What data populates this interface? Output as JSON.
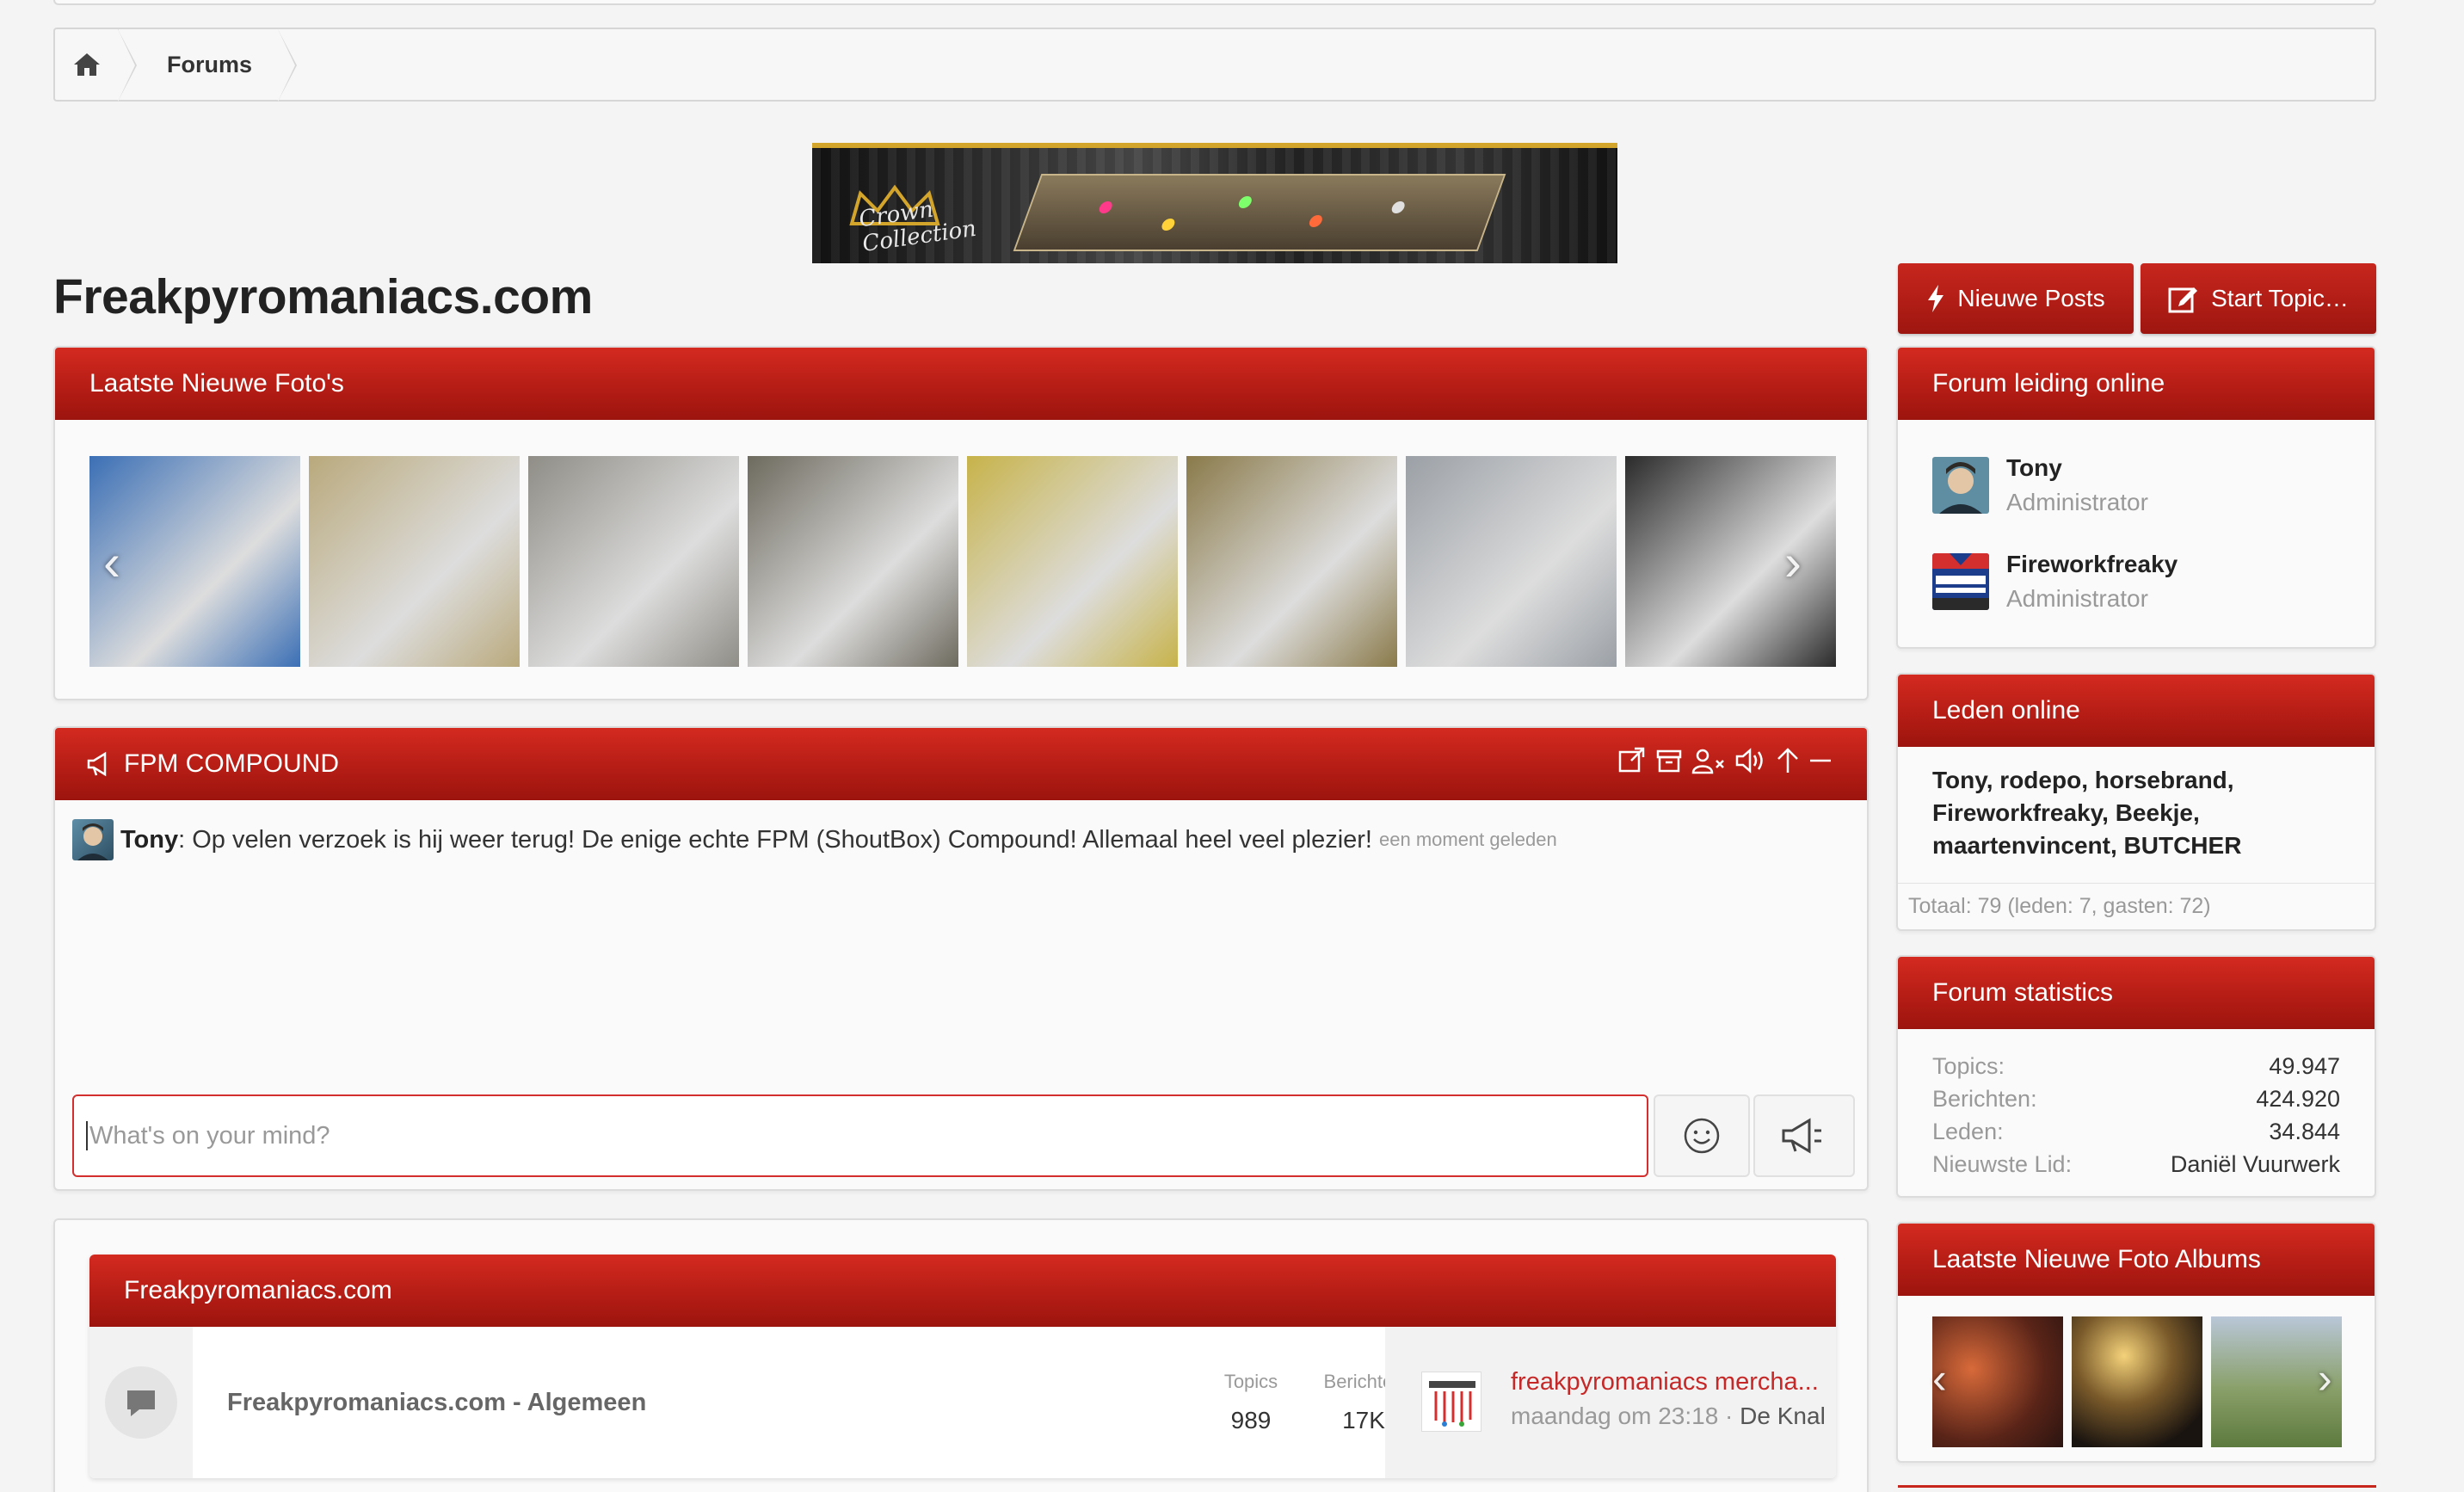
{
  "breadcrumb": {
    "home_icon": "home-icon",
    "items": [
      {
        "label": "Forums"
      }
    ]
  },
  "banner": {
    "brand_text_line1": "Crown",
    "brand_text_line2": "Collection"
  },
  "page": {
    "title": "Freakpyromaniacs.com"
  },
  "buttons": {
    "new_posts": "Nieuwe Posts",
    "start_topic": "Start Topic…"
  },
  "photos": {
    "title": "Laatste Nieuwe Foto's",
    "prev_icon": "chevron-left-icon",
    "next_icon": "chevron-right-icon",
    "colors": [
      "#3b6fb5",
      "#b9a97c",
      "#8f8d86",
      "#6d6a5e",
      "#c7b34a",
      "#8a7a4a",
      "#9ba0a6",
      "#2a2a2a"
    ]
  },
  "compound": {
    "title": "FPM COMPOUND",
    "tools": [
      "external-link-icon",
      "archive-icon",
      "user-mute-icon",
      "volume-icon",
      "arrow-up-icon",
      "minimize-icon"
    ],
    "messages": [
      {
        "author": "Tony",
        "text": ": Op velen verzoek is hij weer terug! De enige echte FPM (ShoutBox) Compound! Allemaal heel veel plezier!",
        "time": "een moment geleden"
      }
    ],
    "input_placeholder": "What's on your mind?",
    "emoji_icon": "smiley-icon",
    "send_icon": "megaphone-icon"
  },
  "forum": {
    "category": "Freakpyromaniacs.com",
    "rows": [
      {
        "name": "Freakpyromaniacs.com - Algemeen",
        "topics_label": "Topics",
        "topics": "989",
        "posts_label": "Berichten",
        "posts": "17K",
        "last_title": "freakpyromaniacs mercha...",
        "last_time": "maandag om 23:18 ·",
        "last_author": "De Knal"
      }
    ]
  },
  "staff": {
    "title": "Forum leiding online",
    "members": [
      {
        "name": "Tony",
        "role": "Administrator"
      },
      {
        "name": "Fireworkfreaky",
        "role": "Administrator"
      }
    ]
  },
  "online": {
    "title": "Leden online",
    "members": [
      "Tony",
      "rodepo",
      "horsebrand",
      "Fireworkfreaky",
      "Beekje",
      "maartenvincent",
      "BUTCHER"
    ],
    "total": "Totaal: 79 (leden: 7, gasten: 72)"
  },
  "stats": {
    "title": "Forum statistics",
    "rows": [
      {
        "label": "Topics:",
        "value": "49.947"
      },
      {
        "label": "Berichten:",
        "value": "424.920"
      },
      {
        "label": "Leden:",
        "value": "34.844"
      },
      {
        "label": "Nieuwste Lid:",
        "value": "Daniël Vuurwerk"
      }
    ]
  },
  "albums": {
    "title": "Laatste Nieuwe Foto Albums"
  },
  "theme": {
    "accent": "#b51d15",
    "link": "#c62828"
  }
}
